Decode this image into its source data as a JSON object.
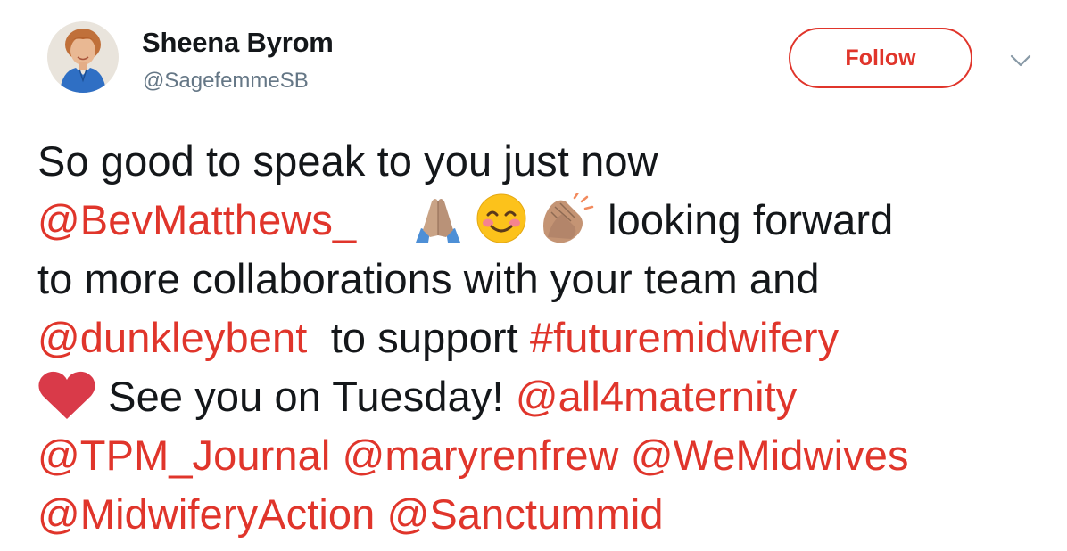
{
  "tweet": {
    "author": {
      "display_name": "Sheena Byrom",
      "handle": "@SagefemmeSB",
      "avatar_icon": "profile-photo"
    },
    "follow_label": "Follow",
    "menu_icon": "chevron-down-icon",
    "accent_color": "#e0352b",
    "body": {
      "line1_text": "So good to speak to you just now",
      "mention_bevmatthews": "@BevMatthews_",
      "emojis": [
        "folded-hands-icon",
        "smiling-face-icon",
        "clapping-hands-icon"
      ],
      "line2_text": " looking forward",
      "line3_text": "to more collaborations with your team and",
      "mention_dunkleybent": "@dunkleybent",
      "line4_text": "  to support ",
      "hashtag_futuremidwifery": "#futuremidwifery",
      "heart_emoji": "red-heart-icon",
      "line5_text": " See you on Tuesday! ",
      "mention_all4maternity": "@all4maternity",
      "mention_tpm_journal": "@TPM_Journal",
      "mention_maryrenfrew": "@maryrenfrew",
      "mention_wemidwives": "@WeMidwives",
      "mention_midwiferyaction": "@MidwiferyAction",
      "mention_sanctummid": "@Sanctummid"
    }
  }
}
